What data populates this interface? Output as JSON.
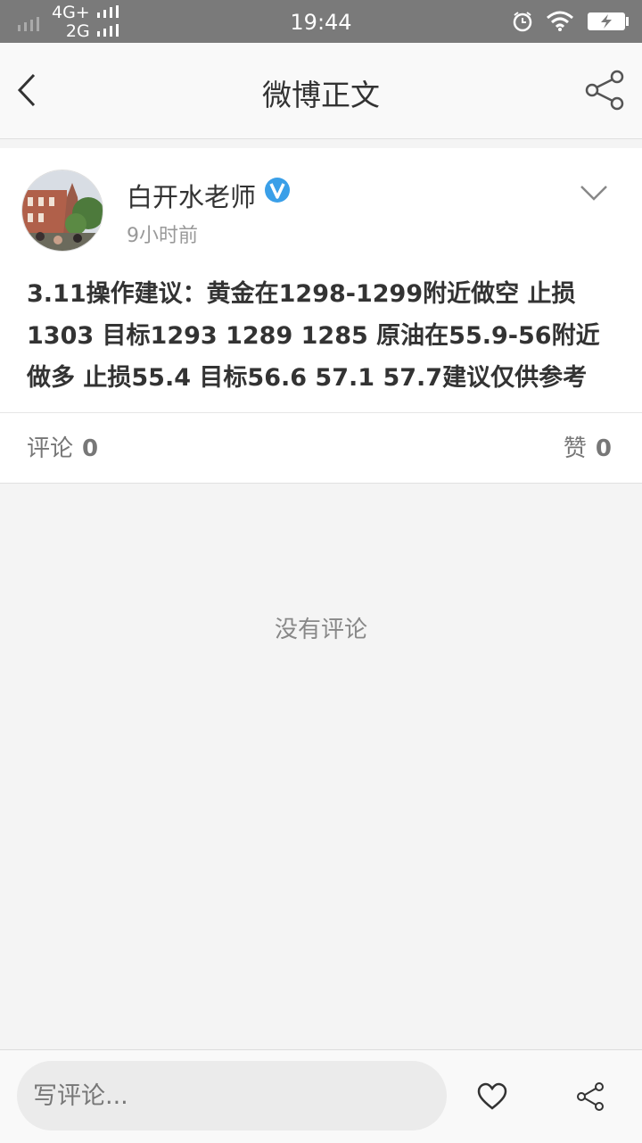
{
  "status_bar": {
    "network_top": "4G+",
    "network_bottom": "2G",
    "time": "19:44"
  },
  "nav": {
    "title": "微博正文"
  },
  "post": {
    "username": "白开水老师",
    "time_ago": "9小时前",
    "content": "3.11操作建议：黄金在1298-1299附近做空 止损1303 目标1293 1289 1285 原油在55.9-56附近做多 止损55.4 目标56.6 57.1 57.7建议仅供参考",
    "comments_label": "评论",
    "comments_count": "0",
    "likes_label": "赞",
    "likes_count": "0"
  },
  "empty_state": "没有评论",
  "bottom_bar": {
    "comment_placeholder": "写评论..."
  },
  "colors": {
    "status_bar_bg": "#7a7a7a",
    "verified_badge": "#3a9fe8"
  }
}
